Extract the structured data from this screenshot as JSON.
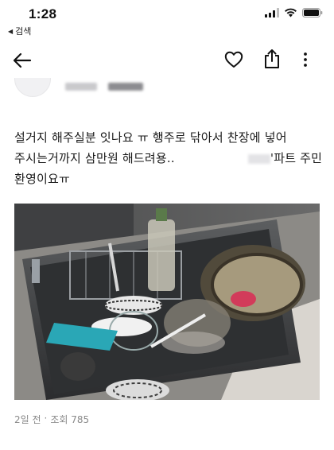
{
  "status": {
    "time": "1:28",
    "back_app": "검색"
  },
  "post": {
    "lines": [
      "설거지 해주실분 잇나요 ㅠ 행주로 닦아서 찬장에 넣어",
      "주시는거까지 삼만원 해드려용..",
      "'파트 주민",
      "환영이요ㅠ"
    ],
    "meta_time": "2일 전",
    "meta_separator": "·",
    "meta_views": "조회 785"
  },
  "icons": {
    "back": "arrow-left-icon",
    "like": "heart-icon",
    "share": "share-icon",
    "more": "more-vertical-icon"
  }
}
